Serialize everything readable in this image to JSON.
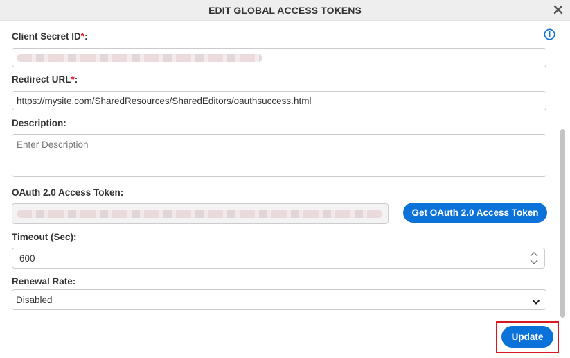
{
  "dialog": {
    "title": "EDIT GLOBAL ACCESS TOKENS",
    "close_icon": "close-icon",
    "info_icon": "info-icon"
  },
  "form": {
    "client_secret_id": {
      "label": "Client Secret ID",
      "required_mark": "*",
      "suffix": ":",
      "value_obscured": true
    },
    "redirect_url": {
      "label": "Redirect URL",
      "required_mark": "*",
      "suffix": ":",
      "value": "https://mysite.com/SharedResources/SharedEditors/oauthsuccess.html"
    },
    "description": {
      "label": "Description:",
      "placeholder": "Enter Description"
    },
    "oauth_token": {
      "label": "OAuth 2.0 Access Token:",
      "value_obscured": true,
      "button_label": "Get OAuth 2.0 Access Token"
    },
    "timeout": {
      "label": "Timeout (Sec):",
      "value": "600"
    },
    "renewal_rate": {
      "label": "Renewal Rate:",
      "selected": "Disabled"
    }
  },
  "footer": {
    "update_label": "Update"
  },
  "colors": {
    "primary": "#0b72d9",
    "required": "#e0141e",
    "highlight": "#d7191f"
  }
}
